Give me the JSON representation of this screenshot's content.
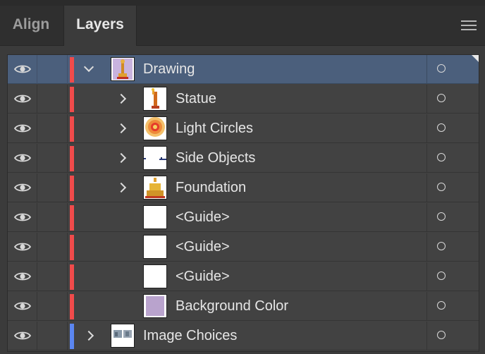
{
  "tabs": {
    "align": "Align",
    "layers": "Layers"
  },
  "layers": [
    {
      "label": "Drawing",
      "level": 0,
      "expanded": true,
      "selected": true,
      "color": "#f04b4b",
      "thumb": "drawing",
      "has_chevron": true
    },
    {
      "label": "Statue",
      "level": 1,
      "expanded": false,
      "selected": false,
      "color": "#f04b4b",
      "thumb": "statue",
      "has_chevron": true
    },
    {
      "label": "Light Circles",
      "level": 1,
      "expanded": false,
      "selected": false,
      "color": "#f04b4b",
      "thumb": "circles",
      "has_chevron": true
    },
    {
      "label": "Side Objects",
      "level": 1,
      "expanded": false,
      "selected": false,
      "color": "#f04b4b",
      "thumb": "side",
      "has_chevron": true
    },
    {
      "label": "Foundation",
      "level": 1,
      "expanded": false,
      "selected": false,
      "color": "#f04b4b",
      "thumb": "foundation",
      "has_chevron": true
    },
    {
      "label": "<Guide>",
      "level": 1,
      "expanded": false,
      "selected": false,
      "color": "#f04b4b",
      "thumb": "blank",
      "has_chevron": false
    },
    {
      "label": "<Guide>",
      "level": 1,
      "expanded": false,
      "selected": false,
      "color": "#f04b4b",
      "thumb": "blank",
      "has_chevron": false
    },
    {
      "label": "<Guide>",
      "level": 1,
      "expanded": false,
      "selected": false,
      "color": "#f04b4b",
      "thumb": "blank",
      "has_chevron": false
    },
    {
      "label": "Background Color",
      "level": 1,
      "expanded": false,
      "selected": false,
      "color": "#f04b4b",
      "thumb": "bgcolor",
      "has_chevron": false
    },
    {
      "label": "Image Choices",
      "level": 0,
      "expanded": false,
      "selected": false,
      "color": "#5b86f0",
      "thumb": "images",
      "has_chevron": true
    }
  ],
  "icons": {
    "visibility": "eye-icon",
    "target": "target-circle-icon",
    "menu": "panel-menu-icon"
  },
  "colors": {
    "selection": "#4b5f7c",
    "layer_red": "#f04b4b",
    "layer_blue": "#5b86f0",
    "bg_swatch": "#b9a3cd"
  }
}
